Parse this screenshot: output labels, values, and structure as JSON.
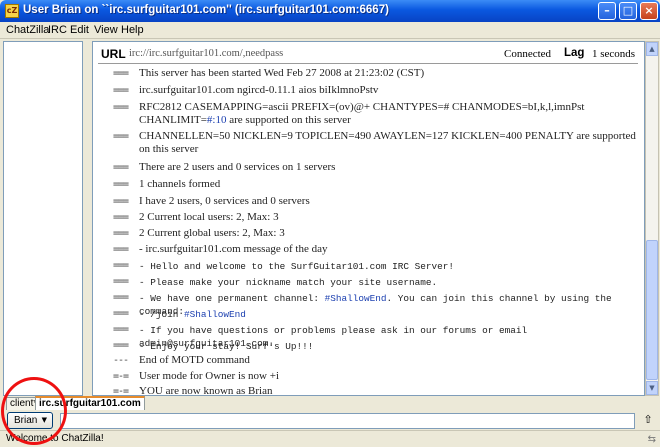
{
  "window": {
    "title": "User Brian on ``irc.surfguitar101.com'' (irc.surfguitar101.com:6667)",
    "icon_text": "cZ",
    "buttons": [
      "minimize",
      "maximize",
      "close"
    ]
  },
  "menu": {
    "items": [
      {
        "label": "ChatZilla",
        "accel": "C"
      },
      {
        "label": "IRC",
        "accel": "I"
      },
      {
        "label": "Edit",
        "accel": "E"
      },
      {
        "label": "View",
        "accel": "V"
      },
      {
        "label": "Help",
        "accel": "H"
      }
    ]
  },
  "header": {
    "url_label": "URL",
    "url_value": "irc://irc.surfguitar101.com/,needpass",
    "connection": "Connected",
    "lag_label": "Lag",
    "lag_value": "1 seconds"
  },
  "messages": [
    {
      "nick": "===",
      "text": "This server has been started Wed Feb 27 2008 at 21:23:02 (CST)"
    },
    {
      "nick": "===",
      "text": "irc.surfguitar101.com ngircd-0.11.1 aios biIklmnoPstv"
    },
    {
      "nick": "===",
      "text": "RFC2812 CASEMAPPING=ascii PREFIX=(ov)@+ CHANTYPES=# CHANMODES=bI,k,l,imnPst",
      "text2a": "CHANLIMIT=",
      "text2b": "#:10",
      "text2c": " are supported on this server"
    },
    {
      "nick": "===",
      "text": "CHANNELLEN=50 NICKLEN=9 TOPICLEN=490 AWAYLEN=127 KICKLEN=400 PENALTY are supported",
      "text2": "on this server"
    },
    {
      "nick": "===",
      "text": "There are 2 users and 0 services on 1 servers"
    },
    {
      "nick": "===",
      "text": "1 channels formed"
    },
    {
      "nick": "===",
      "text": "I have 2 users, 0 services and 0 servers"
    },
    {
      "nick": "===",
      "text": "2 Current local users: 2, Max: 3"
    },
    {
      "nick": "===",
      "text": "2 Current global users: 2, Max: 3"
    },
    {
      "nick": "===",
      "text": "- irc.surfguitar101.com message of the day"
    },
    {
      "nick": "===",
      "text": "- Hello and welcome to the SurfGuitar101.com IRC Server!"
    },
    {
      "nick": "===",
      "text": "- Please make your nickname match your site username."
    },
    {
      "nick": "===",
      "text_a": "- We have one permanent channel: ",
      "text_chan": "#ShallowEnd",
      "text_b": ". You can join this channel by using the command:"
    },
    {
      "nick": "===",
      "text_a": "- /join ",
      "text_chan": "#ShallowEnd"
    },
    {
      "nick": "===",
      "text": "- If you have questions or problems please ask in our forums or email admin@surfguitar101.com."
    },
    {
      "nick": "===",
      "text": "- Enjoy your stay! Surf's Up!!!"
    },
    {
      "nick": "---",
      "text": "End of MOTD command"
    },
    {
      "nick": "=-=",
      "text": "User mode for Owner is now +i"
    },
    {
      "nick": "=-=",
      "text": "YOU are now known as Brian"
    }
  ],
  "tabs": [
    {
      "label": "client*"
    },
    {
      "label": "irc.surfguitar101.com"
    }
  ],
  "input": {
    "nick_button": "Brian",
    "expand_icon": "up-arrow"
  },
  "status": {
    "text": "Welcome to ChatZilla!"
  },
  "colors": {
    "titlebar": "#0a58e0",
    "annotation": "#ee1111",
    "channel_link": "#1b3fb0",
    "active_tab_accent": "#e68b2c"
  }
}
